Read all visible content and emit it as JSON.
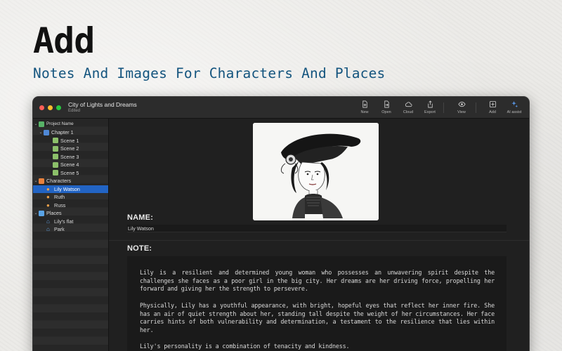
{
  "marketing": {
    "headline": "Add",
    "subheadline": "Notes And Images For Characters And Places"
  },
  "window": {
    "title": "City of Lights and Dreams",
    "status": "Edited"
  },
  "toolbar": {
    "new_label": "New",
    "open_label": "Open",
    "cloud_label": "Cloud",
    "export_label": "Export",
    "view_label": "View",
    "add_label": "Add",
    "ai_label": "AI assist"
  },
  "sidebar": {
    "project": "Project Name",
    "chapter": "Chapter 1",
    "scenes": [
      "Scene 1",
      "Scene 2",
      "Scene 3",
      "Scene 4",
      "Scene 5"
    ],
    "characters_folder": "Characters",
    "characters": [
      "Lily Watson",
      "Ruth",
      "Russ"
    ],
    "places_folder": "Places",
    "places": [
      "Lily's flat",
      "Park"
    ],
    "selected": "Lily Watson"
  },
  "detail": {
    "image_icon": "portrait-sketch-image",
    "name_label": "NAME:",
    "name_value": "Lily Watson",
    "note_label": "NOTE:",
    "note_paragraphs": [
      "Lily is a resilient and determined young woman who possesses an unwavering spirit despite the challenges she faces as a poor girl in the big city. Her dreams are her driving force, propelling her forward and giving her the strength to persevere.",
      "Physically, Lily has a youthful appearance, with bright, hopeful eyes that reflect her inner fire. She has an air of quiet strength about her, standing tall despite the weight of her circumstances. Her face carries hints of both vulnerability and determination, a testament to the resilience that lies within her.",
      "Lily's personality is a combination of tenacity and kindness."
    ]
  },
  "colors": {
    "accent": "#2264c4",
    "subheadline": "#13547e",
    "window_bg": "#1f1f1f"
  }
}
